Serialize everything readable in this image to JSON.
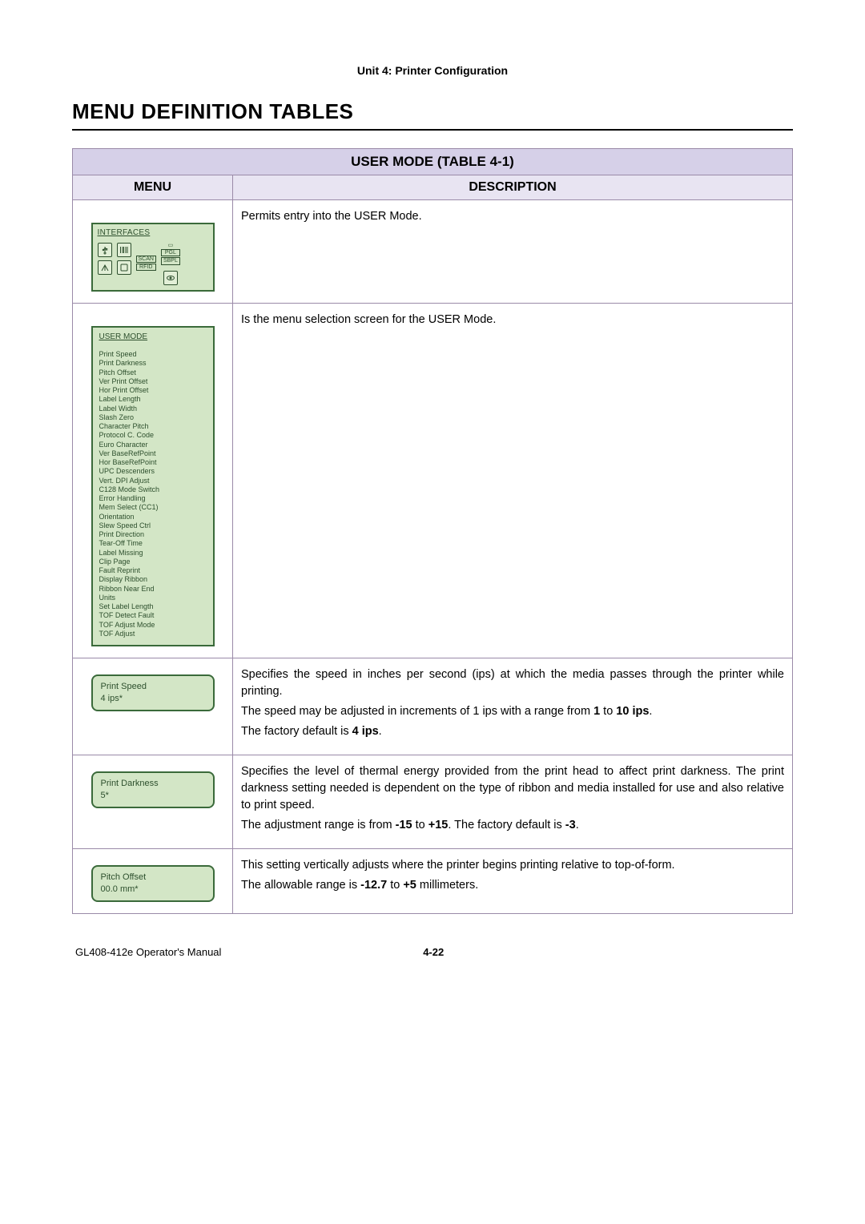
{
  "header": {
    "unit_line": "Unit 4:  Printer Configuration"
  },
  "title": "MENU DEFINITION TABLES",
  "table": {
    "title": "USER MODE (TABLE 4-1)",
    "col_menu": "MENU",
    "col_desc": "DESCRIPTION"
  },
  "row_interfaces": {
    "panel_title": "INTERFACES",
    "labels": {
      "scan": "SCAN",
      "pgl": "PGL",
      "rfid": "RFID",
      "sbpl": "SBPL"
    },
    "desc": "Permits entry into the USER Mode."
  },
  "row_user_mode": {
    "panel_title": "USER MODE",
    "items": [
      "Print Speed",
      "Print Darkness",
      "Pitch Offset",
      "Ver Print Offset",
      "Hor Print Offset",
      "Label Length",
      "Label Width",
      "Slash Zero",
      "Character Pitch",
      "Protocol C. Code",
      "Euro Character",
      "Ver BaseRefPoint",
      "Hor BaseRefPoint",
      "UPC Descenders",
      "Vert. DPI Adjust",
      "C128 Mode Switch",
      "Error Handling",
      "Mem Select (CC1)",
      "Orientation",
      "Slew Speed Ctrl",
      "Print Direction",
      "Tear-Off Time",
      "Label Missing",
      "Clip Page",
      "Fault Reprint",
      "Display Ribbon",
      "Ribbon Near End",
      "Units",
      "Set Label Length",
      "TOF Detect Fault",
      "TOF Adjust Mode",
      "TOF Adjust"
    ],
    "desc": "Is the menu selection screen for the USER Mode."
  },
  "row_print_speed": {
    "menu_title": "Print Speed",
    "menu_value": "4 ips*",
    "desc_p1": "Specifies the speed in inches per second (ips) at which the media passes through the printer while printing.",
    "desc_p2_a": "The speed may be adjusted in increments of 1 ips with a range from ",
    "desc_p2_b1": "1",
    "desc_p2_b2": " to ",
    "desc_p2_b3": "10 ips",
    "desc_p2_b4": ".",
    "desc_p3_a": "The factory default is ",
    "desc_p3_b": "4 ips",
    "desc_p3_c": "."
  },
  "row_print_darkness": {
    "menu_title": "Print Darkness",
    "menu_value": "5*",
    "desc_p1": "Specifies the level of thermal energy provided from the print head to affect print darkness. The print darkness setting needed is dependent on the type of ribbon and media installed for use and also relative to print speed.",
    "desc_p2_a": "The adjustment range is from ",
    "desc_p2_b1": "-15",
    "desc_p2_b2": " to ",
    "desc_p2_b3": "+15",
    "desc_p2_b4": ". The factory default is ",
    "desc_p2_b5": "-3",
    "desc_p2_b6": "."
  },
  "row_pitch_offset": {
    "menu_title": "Pitch Offset",
    "menu_value": "00.0 mm*",
    "desc_p1": "This setting vertically adjusts where the printer begins printing relative to top-of-form.",
    "desc_p2_a": "The allowable range is ",
    "desc_p2_b1": "-12.7",
    "desc_p2_b2": " to ",
    "desc_p2_b3": "+5",
    "desc_p2_b4": " millimeters."
  },
  "footer": {
    "left": "GL408-412e Operator's Manual",
    "page": "4-22"
  }
}
